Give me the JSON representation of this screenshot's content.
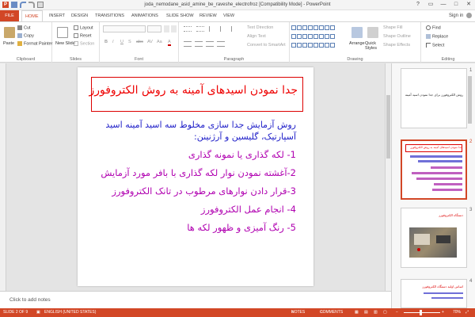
{
  "window": {
    "title": "joda_nemodane_asid_amine_be_raveshe_electrofroz [Compatibility Mode] - PowerPoint",
    "app_badge": "P",
    "help": "?",
    "minimize": "—",
    "maximize": "□",
    "close": "✕"
  },
  "tabs": [
    "FILE",
    "HOME",
    "INSERT",
    "DESIGN",
    "TRANSITIONS",
    "ANIMATIONS",
    "SLIDE SHOW",
    "REVIEW",
    "VIEW"
  ],
  "sign_in": "Sign in",
  "ribbon": {
    "clipboard": {
      "label": "Clipboard",
      "paste": "Paste",
      "cut": "Cut",
      "copy": "Copy",
      "format_painter": "Format Painter"
    },
    "slides": {
      "label": "Slides",
      "new_slide": "New Slide",
      "layout": "Layout",
      "reset": "Reset",
      "section": "Section"
    },
    "font": {
      "label": "Font",
      "buttons": [
        "B",
        "I",
        "U",
        "S",
        "abc",
        "AV",
        "Aa",
        "A"
      ]
    },
    "paragraph": {
      "label": "Paragraph",
      "text_direction": "Text Direction",
      "align_text": "Align Text",
      "convert_smartart": "Convert to SmartArt"
    },
    "drawing": {
      "label": "Drawing",
      "arrange": "Arrange",
      "quick_styles": "Quick Styles",
      "shape_fill": "Shape Fill",
      "shape_outline": "Shape Outline",
      "shape_effects": "Shape Effects"
    },
    "editing": {
      "label": "Editing",
      "find": "Find",
      "replace": "Replace",
      "select": "Select"
    }
  },
  "slide": {
    "title": "جدا نمودن اسیدهای آمینه به روش الکتروفورز",
    "intro": "روش آزمایش جدا سازی مخلوط سه اسید آمینه اسید آسپارتیک، گلیسین و آرژنینن:",
    "items": [
      "1- لکه گذاری یا نمونه گذاری",
      "2-آغشته نمودن نوار لکه گذاری با بافر مورد آزمایش",
      "3-قرار دادن نوارهای مرطوب در تانک الکتروفورز",
      "4- انجام عمل الکتروفورز",
      "5- رنگ آمیزی و ظهور لکه ها"
    ]
  },
  "notes_placeholder": "Click to add notes",
  "thumbnails": [
    {
      "number": "1",
      "text": "روش الکتروفورز برای جدا نمودن اسید آمینه"
    },
    {
      "number": "2",
      "text": "جدا نمودن اسیدهای آمینه به روش الکتروفورز"
    },
    {
      "number": "3",
      "text": "دستگاه الکتروفورز"
    },
    {
      "number": "4",
      "text": "اساس اولیه دستگاه الکتروفورز"
    }
  ],
  "status": {
    "slide_of": "SLIDE 2 OF 9",
    "language": "ENGLISH (UNITED STATES)",
    "notes": "NOTES",
    "comments": "COMMENTS",
    "zoom": "70%"
  },
  "colors": {
    "accent": "#d24726",
    "title_red": "#e00000",
    "body_blue": "#1e1ec8",
    "list_magenta": "#b000b0"
  }
}
